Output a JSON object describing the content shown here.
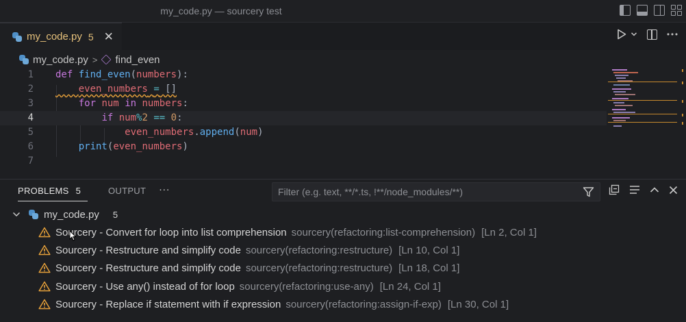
{
  "window": {
    "title": "my_code.py — sourcery test"
  },
  "tab": {
    "filename": "my_code.py",
    "problem_count": "5",
    "close": "✕"
  },
  "breadcrumb": {
    "file": "my_code.py",
    "separator": ">",
    "symbol": "find_even"
  },
  "editor": {
    "line_numbers": [
      "1",
      "2",
      "3",
      "4",
      "5",
      "6",
      "7"
    ],
    "active_line": 4
  },
  "panel": {
    "tabs": [
      {
        "label": "PROBLEMS",
        "badge": "5"
      },
      {
        "label": "OUTPUT"
      },
      {
        "label": "···"
      }
    ],
    "filter_placeholder": "Filter (e.g. text, **/*.ts, !**/node_modules/**)",
    "file": {
      "name": "my_code.py",
      "count": "5"
    },
    "problems": [
      {
        "message": "Sourcery - Convert for loop into list comprehension",
        "source": "sourcery(refactoring:list-comprehension)",
        "location": "[Ln 2, Col 1]"
      },
      {
        "message": "Sourcery - Restructure and simplify code",
        "source": "sourcery(refactoring:restructure)",
        "location": "[Ln 10, Col 1]"
      },
      {
        "message": "Sourcery - Restructure and simplify code",
        "source": "sourcery(refactoring:restructure)",
        "location": "[Ln 18, Col 1]"
      },
      {
        "message": "Sourcery - Use any() instead of for loop",
        "source": "sourcery(refactoring:use-any)",
        "location": "[Ln 24, Col 1]"
      },
      {
        "message": "Sourcery - Replace if statement with if expression",
        "source": "sourcery(refactoring:assign-if-exp)",
        "location": "[Ln 30, Col 1]"
      }
    ]
  },
  "colors": {
    "warning": "#e5a03a",
    "accent_tab": "#e5c07b",
    "keyword": "#c678dd",
    "function": "#61afef",
    "variable": "#e06c75"
  }
}
